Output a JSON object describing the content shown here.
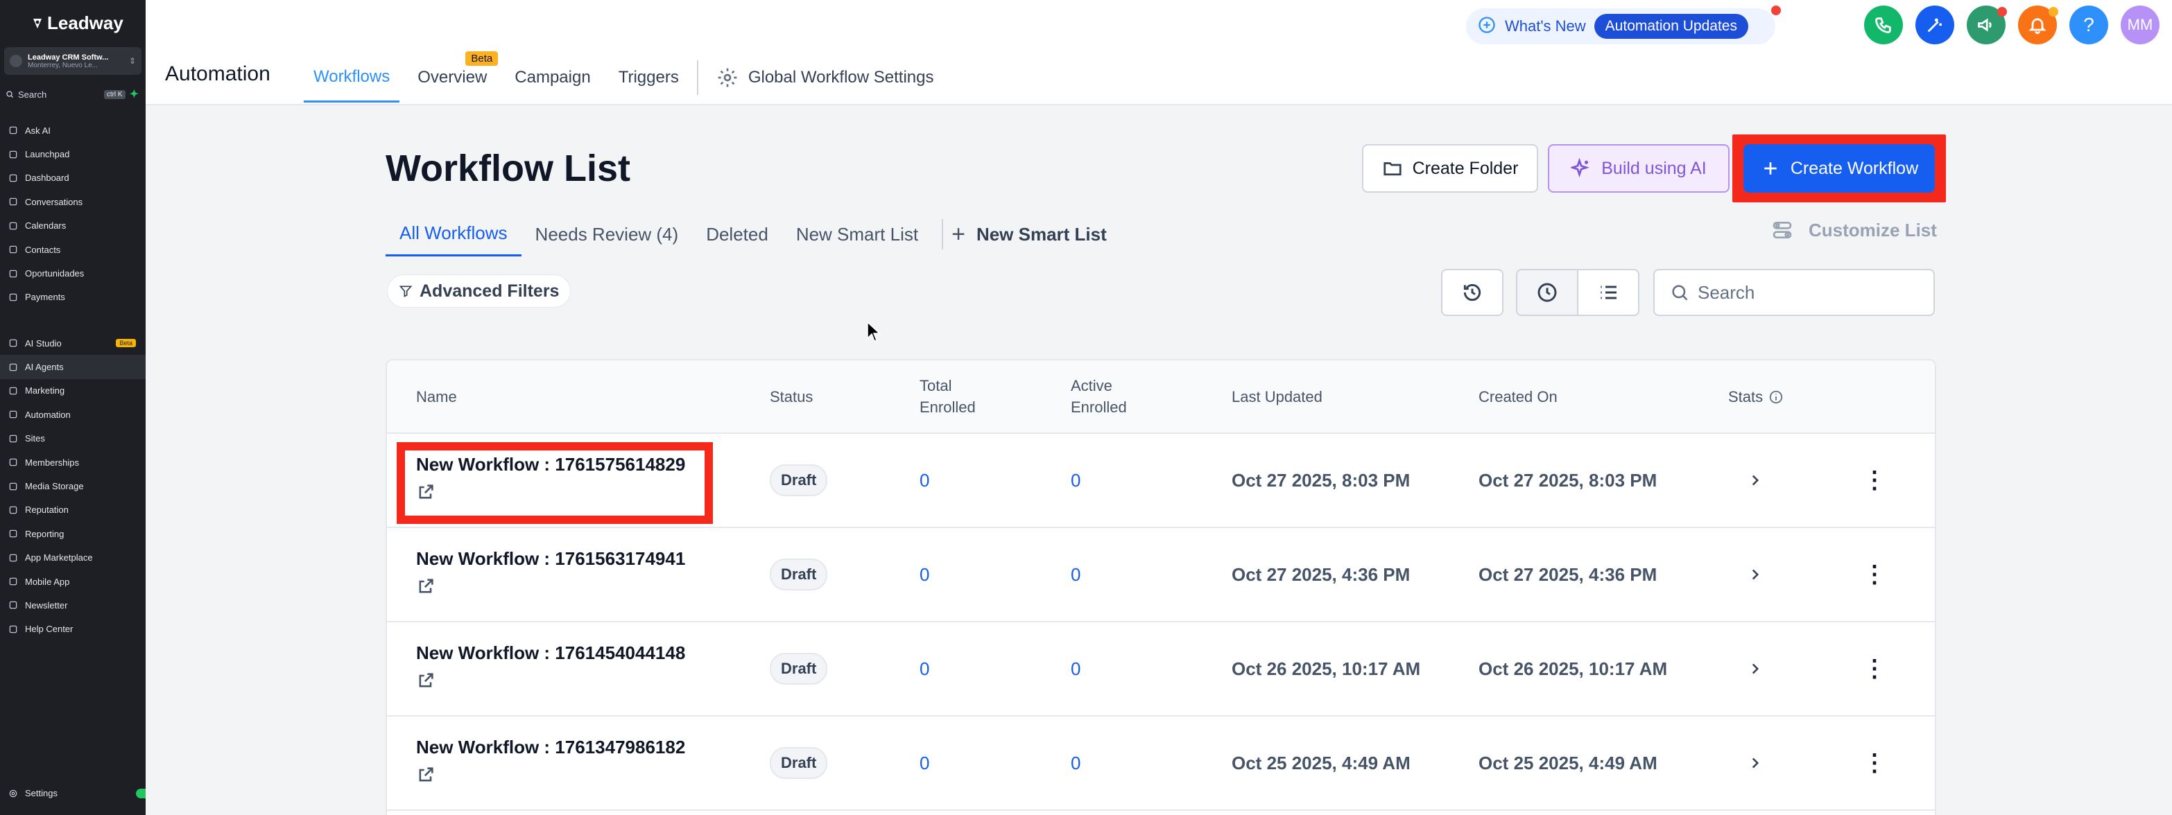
{
  "sidebar": {
    "logo": "Leadway",
    "account": {
      "name": "Leadway CRM Softw...",
      "location": "Monterrey, Nuevo Le..."
    },
    "search": {
      "label": "Search",
      "shortcut": "ctrl K"
    },
    "group1": [
      {
        "label": "Ask AI",
        "icon": "sparkle-icon"
      },
      {
        "label": "Launchpad",
        "icon": "rocket-icon"
      },
      {
        "label": "Dashboard",
        "icon": "grid-icon"
      },
      {
        "label": "Conversations",
        "icon": "chat-icon"
      },
      {
        "label": "Calendars",
        "icon": "calendar-icon"
      },
      {
        "label": "Contacts",
        "icon": "contacts-icon"
      },
      {
        "label": "Oportunidades",
        "icon": "funnel-icon"
      },
      {
        "label": "Payments",
        "icon": "receipt-icon"
      }
    ],
    "group2": [
      {
        "label": "AI Studio",
        "icon": "ai-studio-icon",
        "badge": "Beta"
      },
      {
        "label": "AI Agents",
        "icon": "ai-agents-icon",
        "active": true
      },
      {
        "label": "Marketing",
        "icon": "megaphone-icon"
      },
      {
        "label": "Automation",
        "icon": "automation-icon"
      },
      {
        "label": "Sites",
        "icon": "globe-icon"
      },
      {
        "label": "Memberships",
        "icon": "memberships-icon"
      },
      {
        "label": "Media Storage",
        "icon": "image-icon"
      },
      {
        "label": "Reputation",
        "icon": "star-icon"
      },
      {
        "label": "Reporting",
        "icon": "trend-icon"
      },
      {
        "label": "App Marketplace",
        "icon": "marketplace-icon"
      },
      {
        "label": "Mobile App",
        "icon": "phone-icon"
      },
      {
        "label": "Newsletter",
        "icon": "newsletter-icon"
      },
      {
        "label": "Help Center",
        "icon": "info-icon"
      }
    ],
    "settings_label": "Settings"
  },
  "header": {
    "module_title": "Automation",
    "tabs": [
      {
        "label": "Workflows",
        "active": true
      },
      {
        "label": "Overview",
        "badge": "Beta"
      },
      {
        "label": "Campaign"
      },
      {
        "label": "Triggers"
      }
    ],
    "global_settings_label": "Global Workflow Settings",
    "whats_new": {
      "label": "What's New",
      "pill": "Automation Updates"
    },
    "icons": [
      {
        "name": "phone-icon",
        "color": "#12b76a"
      },
      {
        "name": "magic-wand-icon",
        "color": "#155eef"
      },
      {
        "name": "megaphone-icon",
        "color": "#2e9b6f",
        "dot": "#f04438"
      },
      {
        "name": "bell-icon",
        "color": "#f97316",
        "dot": "#fdb022"
      },
      {
        "name": "help-icon",
        "color": "#2e90fa"
      }
    ],
    "avatar": "MM"
  },
  "page": {
    "title": "Workflow List",
    "buttons": {
      "create_folder": "Create Folder",
      "build_ai": "Build using AI",
      "create_workflow": "Create Workflow"
    },
    "subtabs": [
      {
        "label": "All Workflows",
        "active": true
      },
      {
        "label": "Needs Review (4)"
      },
      {
        "label": "Deleted"
      },
      {
        "label": "New Smart List"
      }
    ],
    "new_smart_list": "New Smart List",
    "customize_list": "Customize List",
    "advanced_filters": "Advanced Filters",
    "search_placeholder": "Search"
  },
  "table": {
    "columns": {
      "name": "Name",
      "status": "Status",
      "total_enrolled": "Total Enrolled",
      "active_enrolled": "Active Enrolled",
      "last_updated": "Last Updated",
      "created_on": "Created On",
      "stats": "Stats"
    },
    "rows": [
      {
        "name": "New Workflow : 1761575614829",
        "status": "Draft",
        "total": "0",
        "active": "0",
        "updated": "Oct 27 2025, 8:03 PM",
        "created": "Oct 27 2025, 8:03 PM",
        "highlighted": true
      },
      {
        "name": "New Workflow : 1761563174941",
        "status": "Draft",
        "total": "0",
        "active": "0",
        "updated": "Oct 27 2025, 4:36 PM",
        "created": "Oct 27 2025, 4:36 PM"
      },
      {
        "name": "New Workflow : 1761454044148",
        "status": "Draft",
        "total": "0",
        "active": "0",
        "updated": "Oct 26 2025, 10:17 AM",
        "created": "Oct 26 2025, 10:17 AM"
      },
      {
        "name": "New Workflow : 1761347986182",
        "status": "Draft",
        "total": "0",
        "active": "0",
        "updated": "Oct 25 2025, 4:49 AM",
        "created": "Oct 25 2025, 4:49 AM"
      }
    ]
  },
  "colors": {
    "accent": "#155eef",
    "highlight": "#f5291b",
    "sidebar_bg": "#1d1f24"
  }
}
